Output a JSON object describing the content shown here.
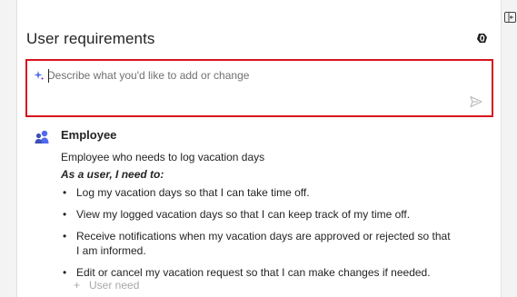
{
  "panel": {
    "title": "User requirements"
  },
  "prompt": {
    "placeholder": "Describe what you'd like to add or change",
    "value": ""
  },
  "persona": {
    "name": "Employee",
    "description": "Employee who needs to log vacation days",
    "need_heading": "As a user, I need to:",
    "needs": [
      "Log my vacation days so that I can take time off.",
      "View my logged vacation days so that I can keep track of my time off.",
      "Receive notifications when my vacation days are approved or rejected so that I am informed.",
      "Edit or cancel my vacation request so that I can make changes if needed."
    ],
    "add_need_label": "User need"
  },
  "icons": {
    "collapse": "collapse-panel-icon",
    "copilot": "copilot-icon",
    "sparkle": "sparkle-icon",
    "send": "send-icon",
    "avatar": "people-icon",
    "add": "plus-icon"
  },
  "colors": {
    "highlight_border": "#d7141f",
    "accent_blue": "#4f6bed",
    "text": "#242424",
    "placeholder": "#707070",
    "muted": "#a8a8a8"
  }
}
